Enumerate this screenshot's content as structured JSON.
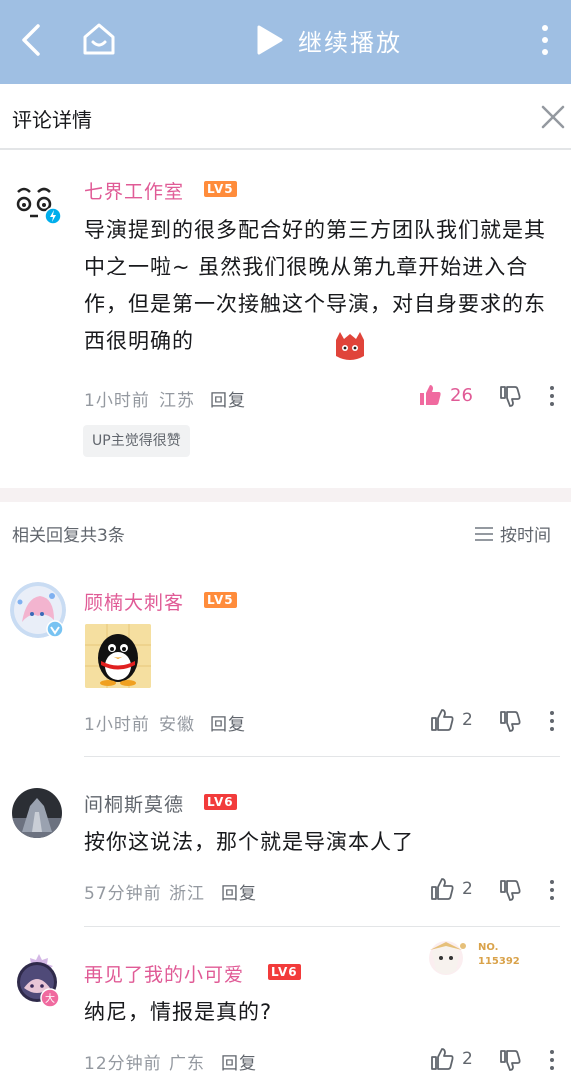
{
  "topbar": {
    "continue_label": "继续播放",
    "icons": [
      "back-icon",
      "home-icon",
      "play-icon",
      "more-vertical-icon"
    ],
    "bg_color": "#9fbfe3"
  },
  "detail": {
    "title": "评论详情",
    "close_icon": "close-icon"
  },
  "main_comment": {
    "username": "七界工作室",
    "level": "LV5",
    "content": "导演提到的很多配合好的第三方团队我们就是其中之一啦~ 虽然我们很晚从第九章开始进入合作，但是第一次接触这个导演，对自身要求的东西很明确的",
    "time": "1小时前",
    "location": "江苏",
    "reply_label": "回复",
    "likes": "26",
    "up_badge": "UP主觉得很赞"
  },
  "replies_header": {
    "count_text": "相关回复共3条",
    "sort_label": "按时间"
  },
  "replies": [
    {
      "username": "顾楠大刺客",
      "level": "LV5",
      "content": "",
      "time": "1小时前",
      "location": "安徽",
      "reply_label": "回复",
      "likes": "2"
    },
    {
      "username": "间桐斯莫德",
      "level": "LV6",
      "content": "按你这说法，那个就是导演本人了",
      "time": "57分钟前",
      "location": "浙江",
      "reply_label": "回复",
      "likes": "2"
    },
    {
      "username": "再见了我的小可爱",
      "level": "LV6",
      "content": "纳尼，情报是真的?",
      "time": "12分钟前",
      "location": "广东",
      "reply_label": "回复",
      "likes": "2",
      "fan_badge": "NO.\n115392"
    }
  ],
  "colors": {
    "accent_pink": "#e05b96",
    "lv5": "#ff8c3b",
    "lv6": "#f23b3b"
  }
}
